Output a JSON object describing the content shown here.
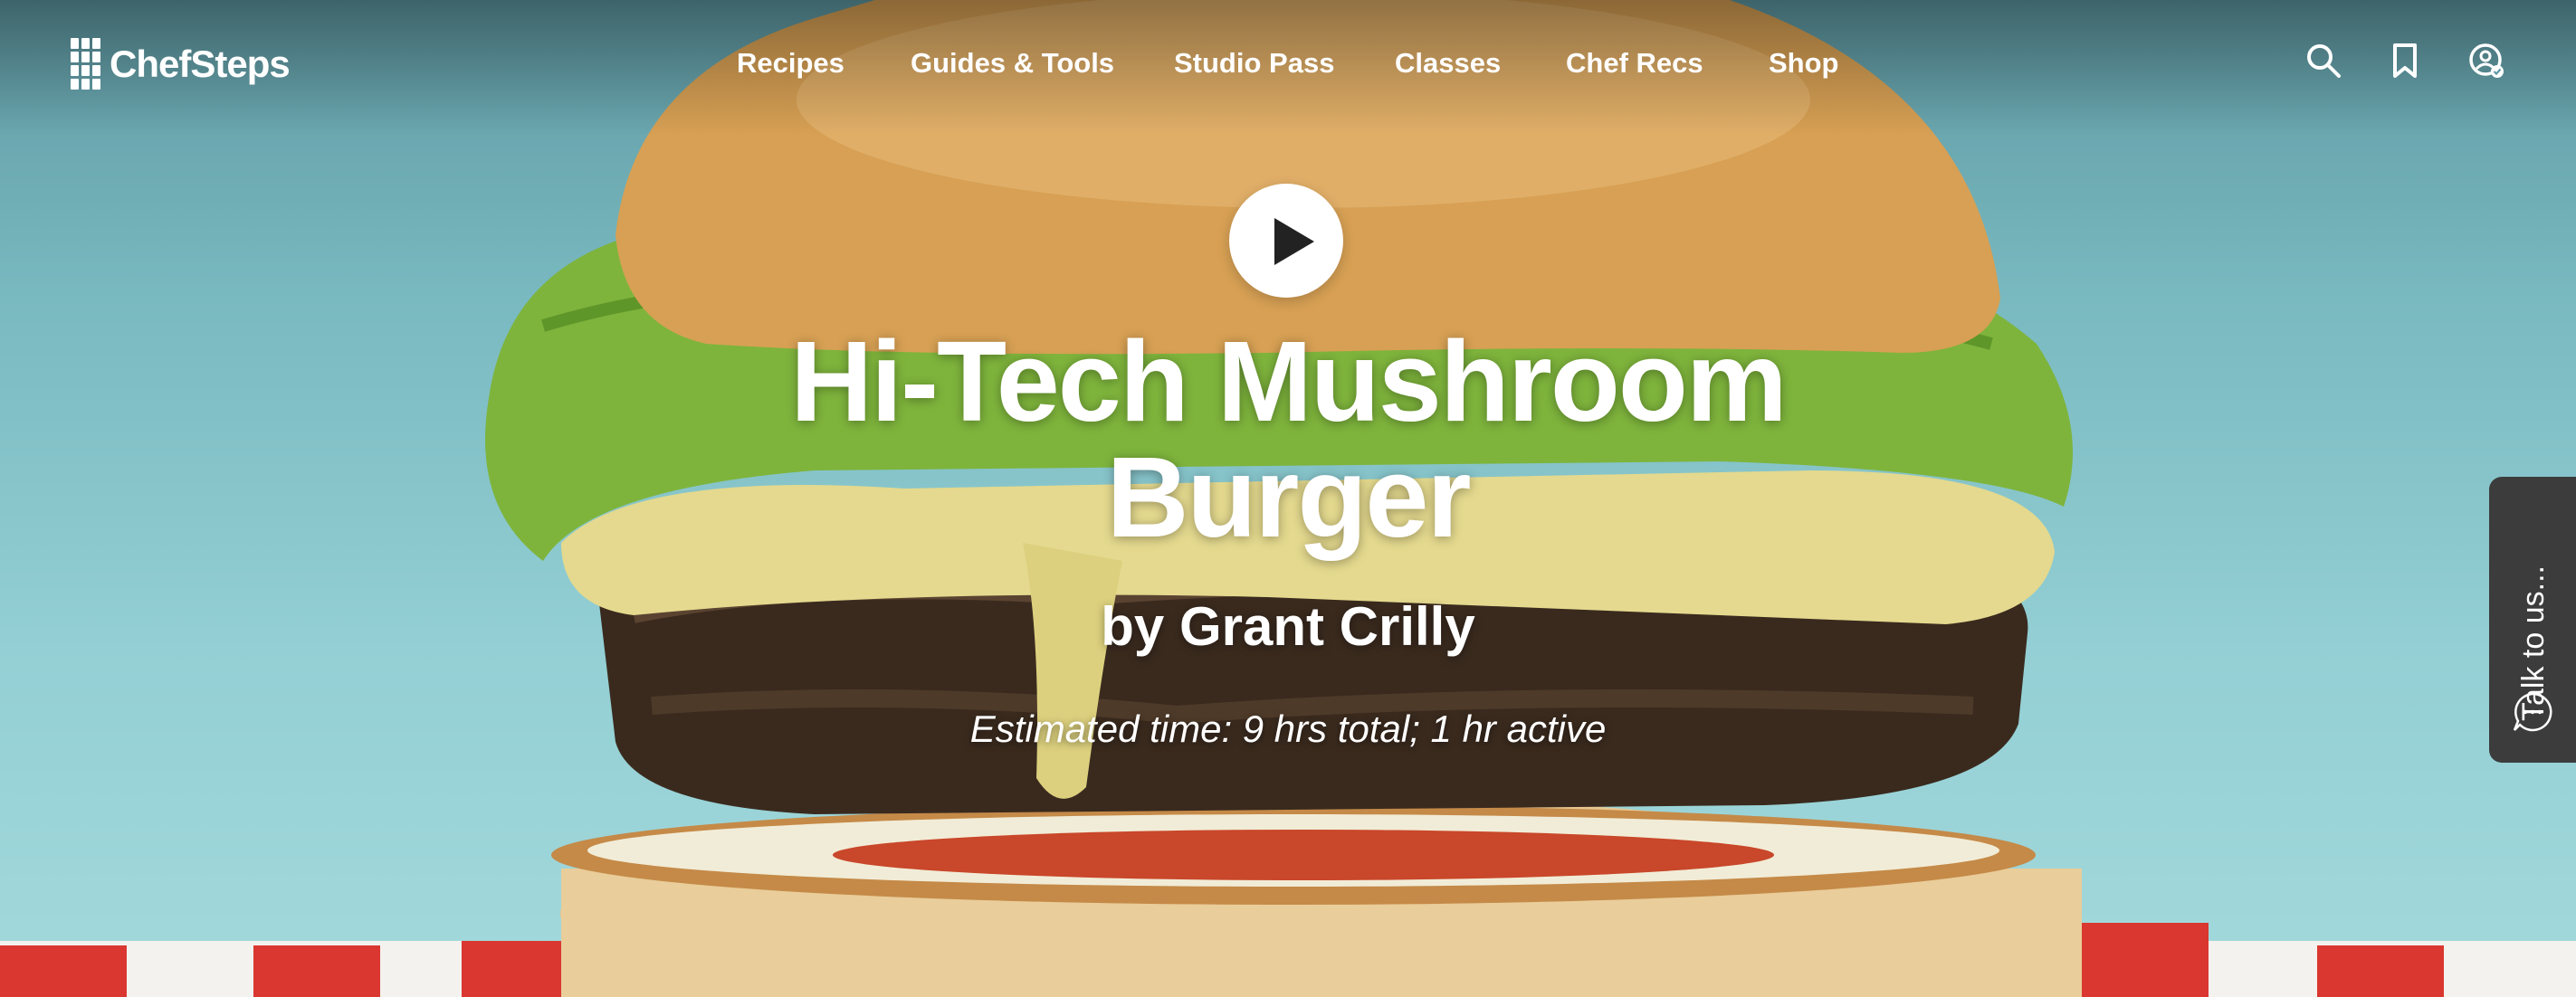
{
  "brand": {
    "name": "ChefSteps"
  },
  "nav": {
    "items": [
      {
        "label": "Recipes"
      },
      {
        "label": "Guides & Tools"
      },
      {
        "label": "Studio Pass"
      },
      {
        "label": "Classes"
      },
      {
        "label": "Chef Recs"
      },
      {
        "label": "Shop"
      }
    ]
  },
  "header_icons": [
    "search-icon",
    "bookmark-icon",
    "account-icon"
  ],
  "hero": {
    "title": "Hi-Tech Mushroom Burger",
    "author": "by Grant Crilly",
    "time": "Estimated time: 9 hrs total; 1 hr active"
  },
  "chat": {
    "label": "Talk to us..."
  },
  "colors": {
    "background": "#7fbfc5",
    "bun": "#d7a054",
    "lettuce": "#7eb43c",
    "cheese": "#e4d98e",
    "patty": "#3a2a1e",
    "tomato": "#c9472a",
    "checker_red": "#d9372f",
    "chat_panel": "#3c3c3c"
  }
}
